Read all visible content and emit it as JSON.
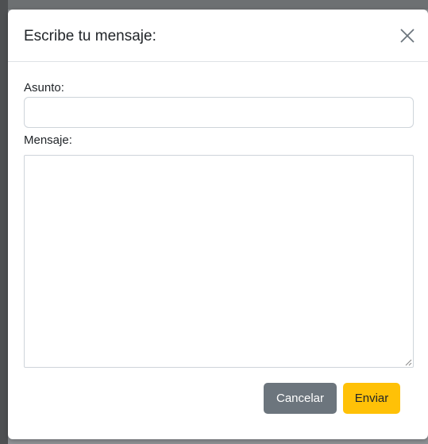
{
  "modal": {
    "title": "Escribe tu mensaje:",
    "close_icon": "close-icon"
  },
  "form": {
    "subject_label": "Asunto:",
    "subject_value": "",
    "subject_placeholder": "",
    "message_label": "Mensaje:",
    "message_value": "",
    "message_placeholder": ""
  },
  "buttons": {
    "cancel_label": "Cancelar",
    "send_label": "Enviar"
  },
  "colors": {
    "cancel_bg": "#6c757d",
    "send_bg": "#ffc107",
    "border": "#ced4da"
  }
}
